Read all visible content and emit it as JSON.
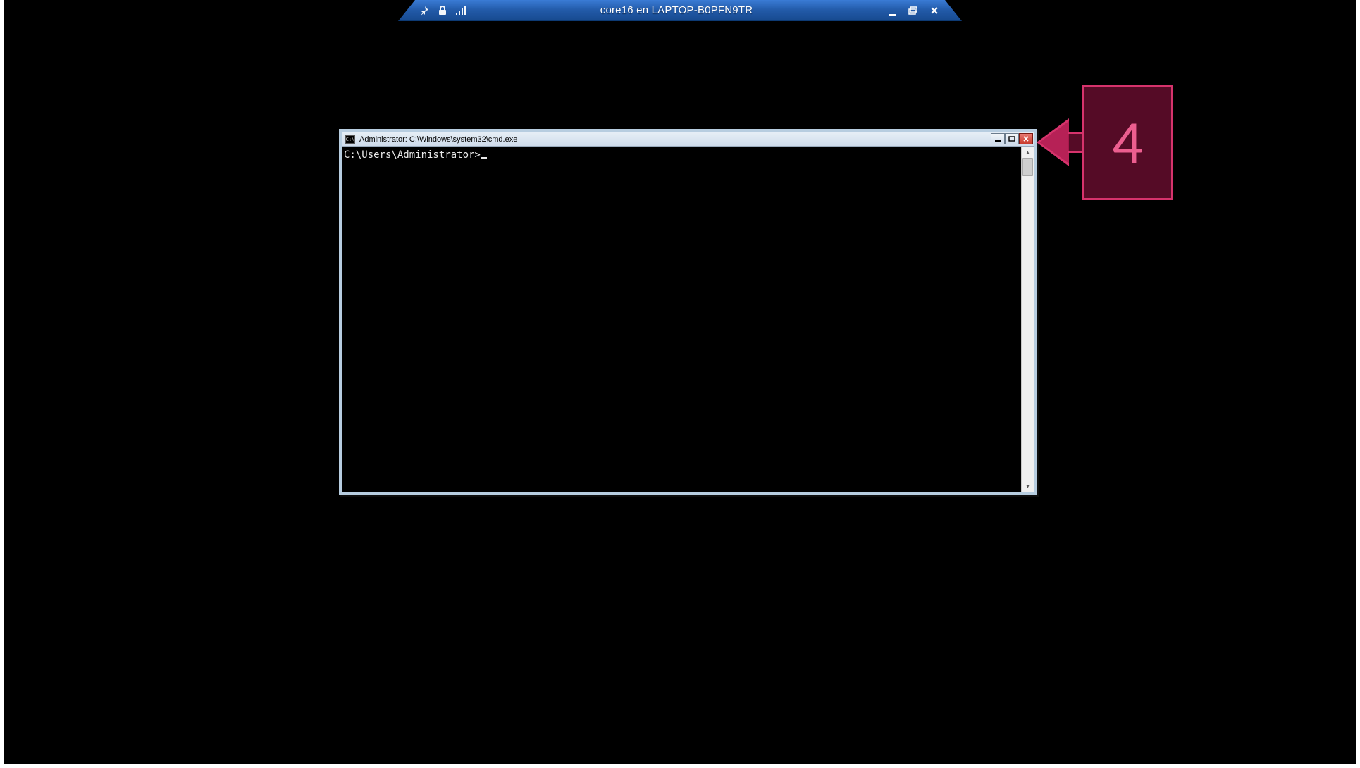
{
  "rdp_bar": {
    "title": "core16 en LAPTOP-B0PFN9TR",
    "icons": {
      "pin": "pin-icon",
      "lock": "lock-icon",
      "signal": "signal-icon",
      "minimize": "minimize-icon",
      "restore": "restore-icon",
      "close": "close-icon"
    }
  },
  "cmd": {
    "title": "Administrator: C:\\Windows\\system32\\cmd.exe",
    "prompt": "C:\\Users\\Administrator>",
    "icon_glyph": "C:\\"
  },
  "callout": {
    "number": "4"
  }
}
